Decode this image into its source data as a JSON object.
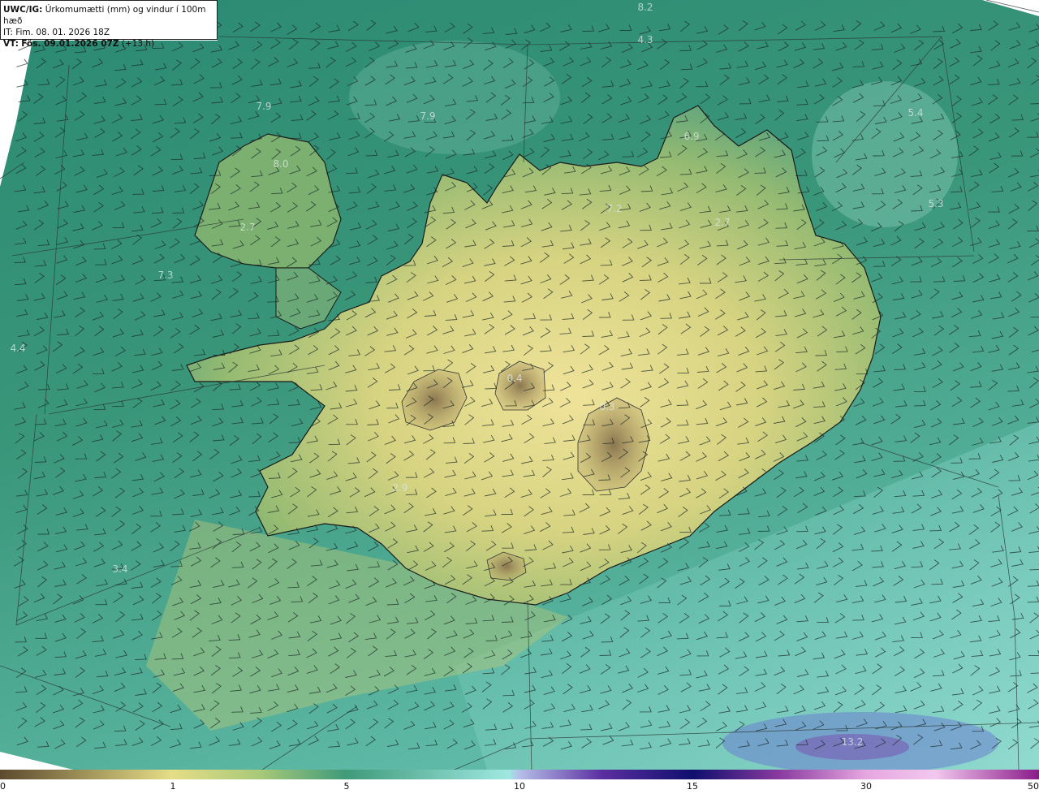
{
  "header": {
    "model": "UWC/IG:",
    "title": "Úrkomumætti (mm) og vindur í 100m hæð",
    "it": "IT: Fim. 08. 01. 2026 18Z",
    "vt_label": "VT:",
    "vt_bold": "Fös. 09.01.2026 07Z",
    "vt_offset": "(+13 h)"
  },
  "value_labels": [
    "8.2",
    "4.3",
    "7.9",
    "7.9",
    "6.9",
    "5.4",
    "8.0",
    "7.2",
    "2.7",
    "5.3",
    "2.7",
    "7.3",
    "4.4",
    "0.4",
    "0.3",
    "2.9",
    "3.4",
    "13.2"
  ],
  "colorbar": {
    "ticks": [
      "0",
      "1",
      "5",
      "10",
      "15",
      "30",
      "50"
    ],
    "colors": [
      "#5c4a2e",
      "#b09a5c",
      "#e5dd86",
      "#3f9a7a",
      "#9fe8e2",
      "#5a2ea0",
      "#0f0f6e",
      "#8a3aa0",
      "#e6a6e0"
    ]
  },
  "palette": {
    "sea": "#2f8e78",
    "land_low": "#9ab86e",
    "land_high": "#e8d98a",
    "dry": "#8d7a54",
    "coast": "#1a1a1a"
  }
}
